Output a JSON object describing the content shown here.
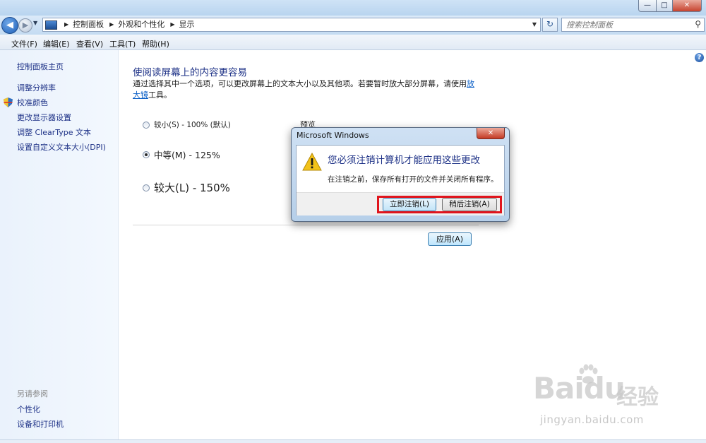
{
  "window": {
    "caption": {
      "min": "—",
      "max": "□",
      "close": "✕"
    }
  },
  "nav": {
    "breadcrumbs": [
      "控制面板",
      "外观和个性化",
      "显示"
    ],
    "search_placeholder": "搜索控制面板"
  },
  "menu": [
    "文件(F)",
    "编辑(E)",
    "查看(V)",
    "工具(T)",
    "帮助(H)"
  ],
  "sidebar": {
    "home": "控制面板主页",
    "links": [
      "调整分辨率",
      "校准颜色",
      "更改显示器设置",
      "调整 ClearType 文本",
      "设置自定义文本大小(DPI)"
    ],
    "see_also": "另请参阅",
    "see_also_links": [
      "个性化",
      "设备和打印机"
    ]
  },
  "main": {
    "title": "使阅读屏幕上的内容更容易",
    "desc_before": "通过选择其中一个选项，可以更改屏幕上的文本大小以及其他项。若要暂时放大部分屏幕，请使用",
    "desc_link": "放大镜",
    "desc_after": "工具。",
    "options": [
      {
        "label": "较小(S) - 100% (默认)",
        "checked": false
      },
      {
        "label": "中等(M) - 125%",
        "checked": true
      },
      {
        "label": "较大(L) - 150%",
        "checked": false
      }
    ],
    "preview_label": "预览",
    "apply_button": "应用(A)"
  },
  "dialog": {
    "title": "Microsoft Windows",
    "main_instruction": "您必须注销计算机才能应用这些更改",
    "content": "在注销之前，保存所有打开的文件并关闭所有程序。",
    "logoff_now": "立即注销(L)",
    "logoff_later": "稍后注销(A)"
  },
  "watermark": {
    "brand": "Bai",
    "brand_tail": "du",
    "cn": "经验",
    "url": "jingyan.baidu.com"
  },
  "colors": {
    "link": "#1e3287",
    "highlight": "#e0141c",
    "warning": "#f2c21a"
  }
}
